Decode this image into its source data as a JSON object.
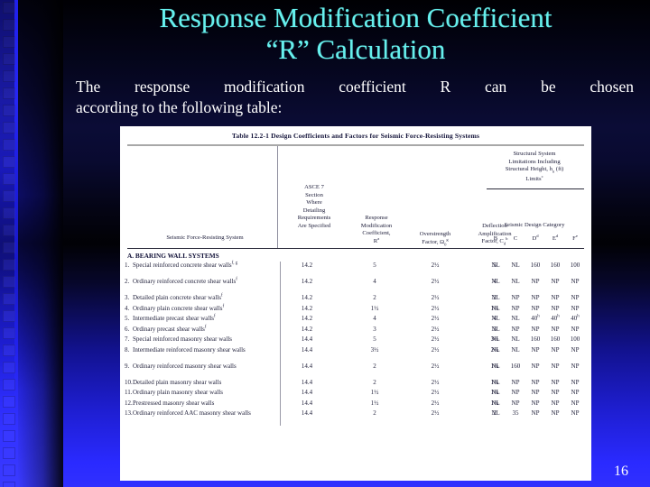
{
  "slide": {
    "title_line1": "Response Modification Coefficient",
    "title_line2": "“R” Calculation",
    "body_line1": "The response modification coefficient R can be chosen",
    "body_line2": "according to the following table:",
    "slide_number": "16",
    "title_color": "#66f0ee",
    "body_color": "#ffffff",
    "accent_blue": "#2a2aff"
  },
  "table": {
    "caption": "Table 12.2-1  Design Coefficients and Factors for Seismic Force-Resisting Systems",
    "headers": {
      "system": "Seismic Force-Resisting System",
      "asce7": "ASCE 7 Section Where Detailing Requirements Are Specified",
      "asce7_lines": [
        "ASCE 7",
        "Section",
        "Where",
        "Detailing",
        "Requirements",
        "Are Specified"
      ],
      "response_lines": [
        "Response",
        "Modification",
        "Coefficient,",
        "R"
      ],
      "response_sup": "a",
      "overstrength_lines": [
        "Overstrength",
        "Factor, Ω"
      ],
      "overstrength_sub": "0",
      "overstrength_sup": "g",
      "deflection_lines": [
        "Deflection",
        "Amplification",
        "Factor, C"
      ],
      "deflection_sub": "d",
      "deflection_sup": "b",
      "limits_lines": [
        "Structural System",
        "Limitations Including",
        "Structural Height, h",
        "Limits"
      ],
      "limits_sub": "n",
      "limits_unit": "(ft)",
      "limits_sup": "c",
      "sdc_label": "Seismic Design Category",
      "sdc_cols": [
        {
          "label": "B",
          "sup": ""
        },
        {
          "label": "C",
          "sup": ""
        },
        {
          "label": "D",
          "sup": "d"
        },
        {
          "label": "E",
          "sup": "d"
        },
        {
          "label": "F",
          "sup": "e"
        }
      ]
    },
    "section": "A.  BEARING WALL SYSTEMS",
    "rows": [
      {
        "num": "1.",
        "name": "Special reinforced concrete shear walls",
        "name_sup": "f, g",
        "asce7": "14.2",
        "R": "5",
        "omega": "2½",
        "Cd": "5",
        "sdc": [
          "NL",
          "NL",
          "160",
          "160",
          "100"
        ],
        "lines": 2
      },
      {
        "num": "2.",
        "name": "Ordinary reinforced concrete shear walls",
        "name_sup": "f",
        "asce7": "14.2",
        "R": "4",
        "omega": "2½",
        "Cd": "4",
        "sdc": [
          "NL",
          "NL",
          "NP",
          "NP",
          "NP"
        ],
        "lines": 2
      },
      {
        "num": "3.",
        "name": "Detailed plain concrete shear walls",
        "name_sup": "f",
        "asce7": "14.2",
        "R": "2",
        "omega": "2½",
        "Cd": "2",
        "sdc": [
          "NL",
          "NP",
          "NP",
          "NP",
          "NP"
        ],
        "lines": 1
      },
      {
        "num": "4.",
        "name": "Ordinary plain concrete shear walls",
        "name_sup": "f",
        "asce7": "14.2",
        "R": "1½",
        "omega": "2½",
        "Cd": "1½",
        "sdc": [
          "NL",
          "NP",
          "NP",
          "NP",
          "NP"
        ],
        "lines": 1
      },
      {
        "num": "5.",
        "name": "Intermediate precast shear walls",
        "name_sup": "f",
        "asce7": "14.2",
        "R": "4",
        "omega": "2½",
        "Cd": "4",
        "sdc": [
          "NL",
          "NL",
          "40",
          "40",
          "40"
        ],
        "sdc_sup": [
          "",
          "",
          "h",
          "h",
          "h"
        ],
        "lines": 1
      },
      {
        "num": "6.",
        "name": "Ordinary precast shear walls",
        "name_sup": "f",
        "asce7": "14.2",
        "R": "3",
        "omega": "2½",
        "Cd": "3",
        "sdc": [
          "NL",
          "NP",
          "NP",
          "NP",
          "NP"
        ],
        "lines": 1
      },
      {
        "num": "7.",
        "name": "Special reinforced masonry shear walls",
        "name_sup": "",
        "asce7": "14.4",
        "R": "5",
        "omega": "2½",
        "Cd": "3½",
        "sdc": [
          "NL",
          "NL",
          "160",
          "160",
          "100"
        ],
        "lines": 1
      },
      {
        "num": "8.",
        "name": "Intermediate reinforced masonry shear walls",
        "name_sup": "",
        "asce7": "14.4",
        "R": "3½",
        "omega": "2½",
        "Cd": "2¼",
        "sdc": [
          "NL",
          "NL",
          "NP",
          "NP",
          "NP"
        ],
        "lines": 2
      },
      {
        "num": "9.",
        "name": "Ordinary reinforced masonry shear walls",
        "name_sup": "",
        "asce7": "14.4",
        "R": "2",
        "omega": "2½",
        "Cd": "1¾",
        "sdc": [
          "NL",
          "160",
          "NP",
          "NP",
          "NP"
        ],
        "lines": 2
      },
      {
        "num": "10.",
        "name": "Detailed plain masonry shear walls",
        "name_sup": "",
        "asce7": "14.4",
        "R": "2",
        "omega": "2½",
        "Cd": "1¾",
        "sdc": [
          "NL",
          "NP",
          "NP",
          "NP",
          "NP"
        ],
        "lines": 1
      },
      {
        "num": "11.",
        "name": "Ordinary plain masonry shear walls",
        "name_sup": "",
        "asce7": "14.4",
        "R": "1½",
        "omega": "2½",
        "Cd": "1¼",
        "sdc": [
          "NL",
          "NP",
          "NP",
          "NP",
          "NP"
        ],
        "lines": 1
      },
      {
        "num": "12.",
        "name": "Prestressed masonry shear walls",
        "name_sup": "",
        "asce7": "14.4",
        "R": "1½",
        "omega": "2½",
        "Cd": "1¾",
        "sdc": [
          "NL",
          "NP",
          "NP",
          "NP",
          "NP"
        ],
        "lines": 1
      },
      {
        "num": "13.",
        "name": "Ordinary reinforced AAC masonry shear walls",
        "name_sup": "",
        "asce7": "14.4",
        "R": "2",
        "omega": "2½",
        "Cd": "2",
        "sdc": [
          "NL",
          "35",
          "NP",
          "NP",
          "NP"
        ],
        "lines": 2
      }
    ]
  }
}
